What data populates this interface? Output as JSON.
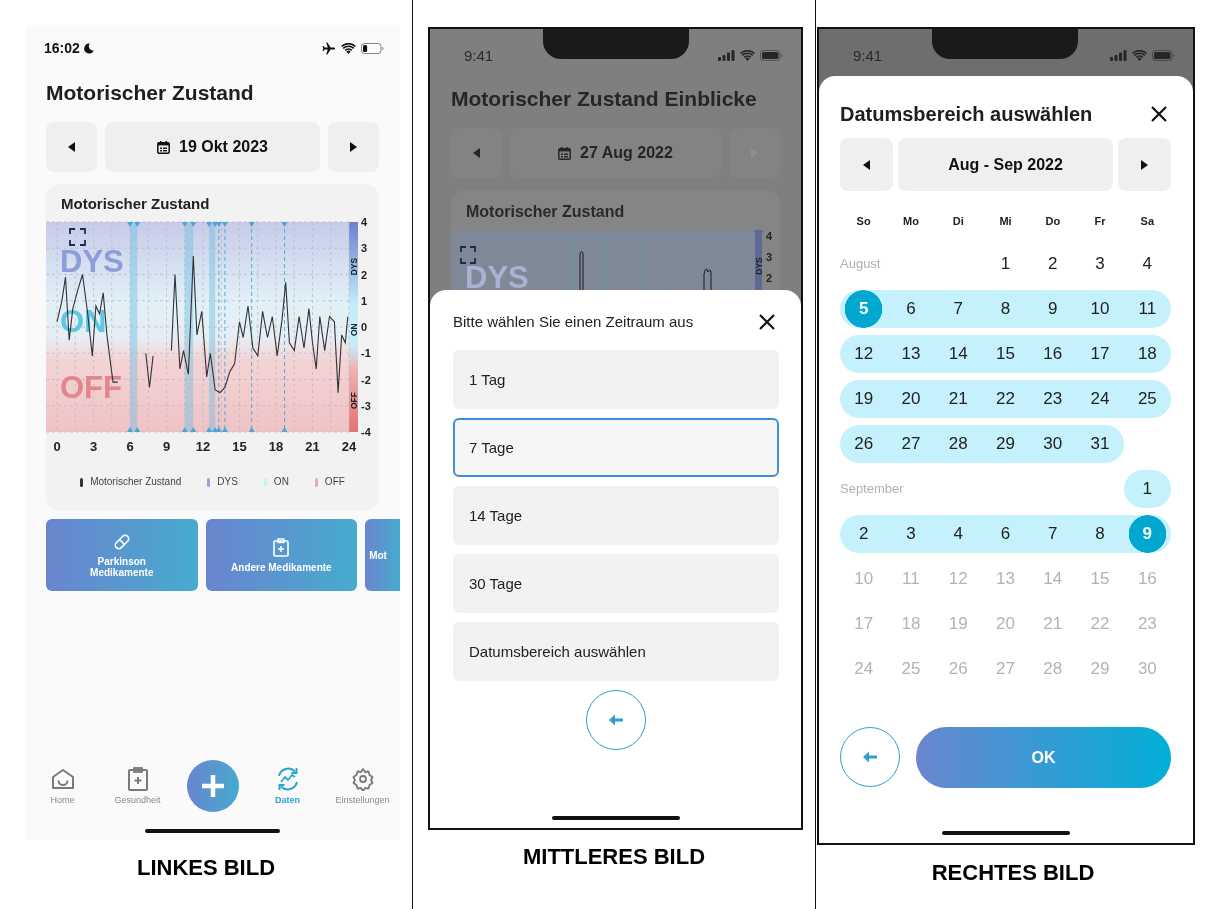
{
  "left_screen": {
    "status_bar": {
      "time": "16:02"
    },
    "title": "Motorischer Zustand",
    "date_nav": {
      "date": "19 Okt 2023",
      "next_disabled": false
    },
    "chart_card": {
      "title": "Motorischer Zustand",
      "zone_labels": [
        "DYS",
        "ON",
        "OFF"
      ],
      "bar_labels": [
        "DYS",
        "ON",
        "OFF"
      ],
      "chart_data": {
        "type": "line",
        "grid": true,
        "xlim": [
          0,
          24
        ],
        "ylim": [
          -4,
          4
        ],
        "xticks": [
          0,
          3,
          6,
          9,
          12,
          15,
          18,
          21,
          24
        ],
        "yticks": [
          -4,
          -3,
          -2,
          -1,
          0,
          1,
          2,
          3,
          4
        ],
        "ref_lines": [
          {
            "axis": "x",
            "value": 13.3
          },
          {
            "axis": "x",
            "value": 13.8
          },
          {
            "axis": "x",
            "value": 16
          },
          {
            "axis": "x",
            "value": 18.7
          }
        ],
        "x": [
          0,
          0.4,
          0.7,
          1,
          1.3,
          1.7,
          2.1,
          2.5,
          2.9,
          3.2,
          3.5,
          3.8,
          4.1,
          4.6,
          5,
          6,
          7.3,
          7.6,
          7.9,
          8.5,
          9.4,
          9.7,
          10.1,
          10.4,
          10.8,
          11.2,
          11.5,
          11.9,
          12.3,
          12.6,
          13,
          13.4,
          13.8,
          14.2,
          14.6,
          15,
          15.3,
          15.7,
          16.1,
          16.5,
          16.9,
          17.3,
          17.7,
          18.1,
          18.5,
          18.8,
          19.1,
          19.5,
          19.9,
          20.3,
          20.7,
          21,
          21.3,
          21.6,
          22,
          22.4,
          22.8,
          23.1,
          23.4,
          23.7,
          23.9
        ],
        "series": [
          {
            "name": "Motorischer Zustand",
            "color": "#333333",
            "values": [
              0.2,
              1,
              1.9,
              -0.5,
              0.7,
              1.4,
              2,
              0.6,
              -1.1,
              0.8,
              0.5,
              1.3,
              -0.3,
              -2.1,
              -2.1,
              null,
              -1,
              -2.3,
              -1.1,
              null,
              -0.9,
              2,
              -1.6,
              -0.9,
              -1.8,
              2.7,
              -0.3,
              0.6,
              -1.9,
              -1,
              -2.4,
              -2.5,
              -2.3,
              -1.7,
              -1.4,
              0.2,
              -0.4,
              0.8,
              -0.8,
              -1.1,
              0.6,
              -0.4,
              0.4,
              -1.1,
              0.3,
              1.7,
              -0.6,
              -0.9,
              0.4,
              -0.8,
              0.7,
              -0.6,
              -1.6,
              0.4,
              -0.9,
              0.4,
              0.2,
              -2.5,
              -0.3,
              -0.6,
              0.4
            ]
          }
        ]
      },
      "legend": [
        {
          "label": "DYS",
          "color": "#93a8de"
        },
        {
          "label": "ON",
          "color": "#c6f0fa"
        },
        {
          "label": "OFF",
          "color": "#eeaaad"
        }
      ]
    },
    "shortcut_tiles": [
      {
        "label": "Parkinson Medikamente",
        "kind": "pill"
      },
      {
        "label": "Andere Medikamente",
        "kind": "clipboard"
      },
      {
        "label": "Mot",
        "kind": "cut"
      }
    ],
    "tab_bar": [
      {
        "label": "Home",
        "kind": "home",
        "selected": false
      },
      {
        "label": "Gesundheit",
        "kind": "health",
        "selected": false
      },
      {
        "kind": "add",
        "selected": false
      },
      {
        "label": "Daten",
        "kind": "data",
        "selected": true
      },
      {
        "label": "Einstellungen",
        "kind": "settings",
        "selected": false
      }
    ],
    "caption": "LINKES BILD"
  },
  "middle_screen": {
    "status_bar": {
      "time": "9:41"
    },
    "title": "Motorischer Zustand Einblicke",
    "date_nav": {
      "date": "27 Aug 2022",
      "next_disabled": true
    },
    "chart_card": {
      "title": "Motorischer Zustand",
      "zone_label": "DYS",
      "bar_label": "DYS",
      "y_labels": [
        "4",
        "3",
        "2"
      ]
    },
    "sheet": {
      "title": "Bitte wählen Sie einen Zeitraum aus",
      "options": [
        {
          "label": "1 Tag",
          "selected": false
        },
        {
          "label": "7 Tage",
          "selected": true
        },
        {
          "label": "14 Tage",
          "selected": false
        },
        {
          "label": "30 Tage",
          "selected": false
        },
        {
          "label": "Datumsbereich auswählen",
          "selected": false
        }
      ]
    },
    "caption": "MITTLERES BILD"
  },
  "right_screen": {
    "status_bar": {
      "time": "9:41"
    },
    "sheet": {
      "title": "Datumsbereich auswählen",
      "month_nav": {
        "label": "Aug - Sep 2022"
      },
      "weekdays": [
        "So",
        "Mo",
        "Di",
        "Mi",
        "Do",
        "Fr",
        "Sa"
      ],
      "rows": [
        {
          "label": "August",
          "cells": [
            "",
            "",
            "",
            {
              "day": "1",
              "in_range": false,
              "selected": false,
              "disabled": false
            },
            {
              "day": "2",
              "in_range": false,
              "selected": false,
              "disabled": false
            },
            {
              "day": "3",
              "in_range": false,
              "selected": false,
              "disabled": false
            },
            {
              "day": "4",
              "in_range": false,
              "selected": false,
              "disabled": false
            }
          ]
        },
        {
          "cells": [
            {
              "day": "5",
              "in_range": true,
              "selected": true,
              "disabled": false
            },
            {
              "day": "6",
              "in_range": true,
              "selected": false,
              "disabled": false
            },
            {
              "day": "7",
              "in_range": true,
              "selected": false,
              "disabled": false
            },
            {
              "day": "8",
              "in_range": true,
              "selected": false,
              "disabled": false
            },
            {
              "day": "9",
              "in_range": true,
              "selected": false,
              "disabled": false
            },
            {
              "day": "10",
              "in_range": true,
              "selected": false,
              "disabled": false
            },
            {
              "day": "11",
              "in_range": true,
              "selected": false,
              "disabled": false
            }
          ]
        },
        {
          "cells": [
            {
              "day": "12",
              "in_range": true,
              "selected": false,
              "disabled": false
            },
            {
              "day": "13",
              "in_range": true,
              "selected": false,
              "disabled": false
            },
            {
              "day": "14",
              "in_range": true,
              "selected": false,
              "disabled": false
            },
            {
              "day": "15",
              "in_range": true,
              "selected": false,
              "disabled": false
            },
            {
              "day": "16",
              "in_range": true,
              "selected": false,
              "disabled": false
            },
            {
              "day": "17",
              "in_range": true,
              "selected": false,
              "disabled": false
            },
            {
              "day": "18",
              "in_range": true,
              "selected": false,
              "disabled": false
            }
          ]
        },
        {
          "cells": [
            {
              "day": "19",
              "in_range": true,
              "selected": false,
              "disabled": false
            },
            {
              "day": "20",
              "in_range": true,
              "selected": false,
              "disabled": false
            },
            {
              "day": "21",
              "in_range": true,
              "selected": false,
              "disabled": false
            },
            {
              "day": "22",
              "in_range": true,
              "selected": false,
              "disabled": false
            },
            {
              "day": "23",
              "in_range": true,
              "selected": false,
              "disabled": false
            },
            {
              "day": "24",
              "in_range": true,
              "selected": false,
              "disabled": false
            },
            {
              "day": "25",
              "in_range": true,
              "selected": false,
              "disabled": false
            }
          ]
        },
        {
          "cells": [
            {
              "day": "26",
              "in_range": true,
              "selected": false,
              "disabled": false
            },
            {
              "day": "27",
              "in_range": true,
              "selected": false,
              "disabled": false
            },
            {
              "day": "28",
              "in_range": true,
              "selected": false,
              "disabled": false
            },
            {
              "day": "29",
              "in_range": true,
              "selected": false,
              "disabled": false
            },
            {
              "day": "30",
              "in_range": true,
              "selected": false,
              "disabled": false
            },
            {
              "day": "31",
              "in_range": true,
              "selected": false,
              "disabled": false
            }
          ]
        },
        {
          "label": "September",
          "cells": [
            "",
            "",
            "",
            "",
            "",
            "",
            {
              "day": "1",
              "in_range": true,
              "selected": false,
              "disabled": false
            }
          ]
        },
        {
          "cells": [
            {
              "day": "2",
              "in_range": true,
              "selected": false,
              "disabled": false
            },
            {
              "day": "3",
              "in_range": true,
              "selected": false,
              "disabled": false
            },
            {
              "day": "4",
              "in_range": true,
              "selected": false,
              "disabled": false
            },
            {
              "day": "6",
              "in_range": true,
              "selected": false,
              "disabled": false
            },
            {
              "day": "7",
              "in_range": true,
              "selected": false,
              "disabled": false
            },
            {
              "day": "8",
              "in_range": true,
              "selected": false,
              "disabled": false
            },
            {
              "day": "9",
              "in_range": true,
              "selected": true,
              "disabled": false
            }
          ]
        },
        {
          "cells": [
            {
              "day": "10",
              "in_range": false,
              "selected": false,
              "disabled": true
            },
            {
              "day": "11",
              "in_range": false,
              "selected": false,
              "disabled": true
            },
            {
              "day": "12",
              "in_range": false,
              "selected": false,
              "disabled": true
            },
            {
              "day": "13",
              "in_range": false,
              "selected": false,
              "disabled": true
            },
            {
              "day": "14",
              "in_range": false,
              "selected": false,
              "disabled": true
            },
            {
              "day": "15",
              "in_range": false,
              "selected": false,
              "disabled": true
            },
            {
              "day": "16",
              "in_range": false,
              "selected": false,
              "disabled": true
            }
          ]
        },
        {
          "cells": [
            {
              "day": "17",
              "in_range": false,
              "selected": false,
              "disabled": true
            },
            {
              "day": "18",
              "in_range": false,
              "selected": false,
              "disabled": true
            },
            {
              "day": "19",
              "in_range": false,
              "selected": false,
              "disabled": true
            },
            {
              "day": "20",
              "in_range": false,
              "selected": false,
              "disabled": true
            },
            {
              "day": "21",
              "in_range": false,
              "selected": false,
              "disabled": true
            },
            {
              "day": "22",
              "in_range": false,
              "selected": false,
              "disabled": true
            },
            {
              "day": "23",
              "in_range": false,
              "selected": false,
              "disabled": true
            }
          ]
        },
        {
          "cells": [
            {
              "day": "24",
              "in_range": false,
              "selected": false,
              "disabled": true
            },
            {
              "day": "25",
              "in_range": false,
              "selected": false,
              "disabled": true
            },
            {
              "day": "26",
              "in_range": false,
              "selected": false,
              "disabled": true
            },
            {
              "day": "27",
              "in_range": false,
              "selected": false,
              "disabled": true
            },
            {
              "day": "28",
              "in_range": false,
              "selected": false,
              "disabled": true
            },
            {
              "day": "29",
              "in_range": false,
              "selected": false,
              "disabled": true
            },
            {
              "day": "30",
              "in_range": false,
              "selected": false,
              "disabled": true
            }
          ]
        }
      ],
      "ok_button": "OK"
    },
    "caption": "RECHTES BILD"
  }
}
